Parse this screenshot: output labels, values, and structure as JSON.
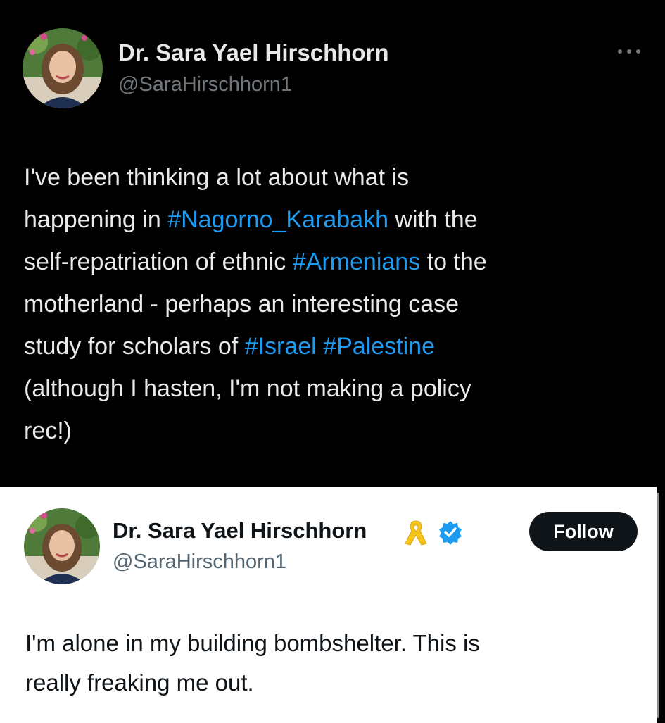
{
  "top_tweet": {
    "author_name": "Dr. Sara Yael Hirschhorn",
    "handle": "@SaraHirschhorn1",
    "text_segments": [
      {
        "text": "I've been thinking a lot about what is\nhappening in ",
        "type": "plain"
      },
      {
        "text": "#Nagorno_Karabakh",
        "type": "hashtag"
      },
      {
        "text": " with the\nself-repatriation of ethnic ",
        "type": "plain"
      },
      {
        "text": "#Armenians",
        "type": "hashtag"
      },
      {
        "text": " to the\nmotherland - perhaps an interesting case\nstudy for scholars of ",
        "type": "plain"
      },
      {
        "text": "#Israel",
        "type": "hashtag"
      },
      {
        "text": " ",
        "type": "plain"
      },
      {
        "text": "#Palestine",
        "type": "hashtag"
      },
      {
        "text": "\n(although I hasten, I'm not making a policy\nrec!)",
        "type": "plain"
      }
    ],
    "more_icon": "more-horizontal-icon"
  },
  "bottom_tweet": {
    "author_name": "Dr. Sara Yael Hirschhorn",
    "handle": "@SaraHirschhorn1",
    "follow_label": "Follow",
    "text": "I'm alone in my building bombshelter.   This is\nreally freaking me out.",
    "badges": [
      "yellow-ribbon-icon",
      "verified-badge-icon"
    ]
  },
  "colors": {
    "hashtag": "#1d9bf0",
    "verified": "#1d9bf0",
    "ribbon": "#f5c518",
    "dark_bg": "#000000",
    "light_bg": "#ffffff"
  }
}
